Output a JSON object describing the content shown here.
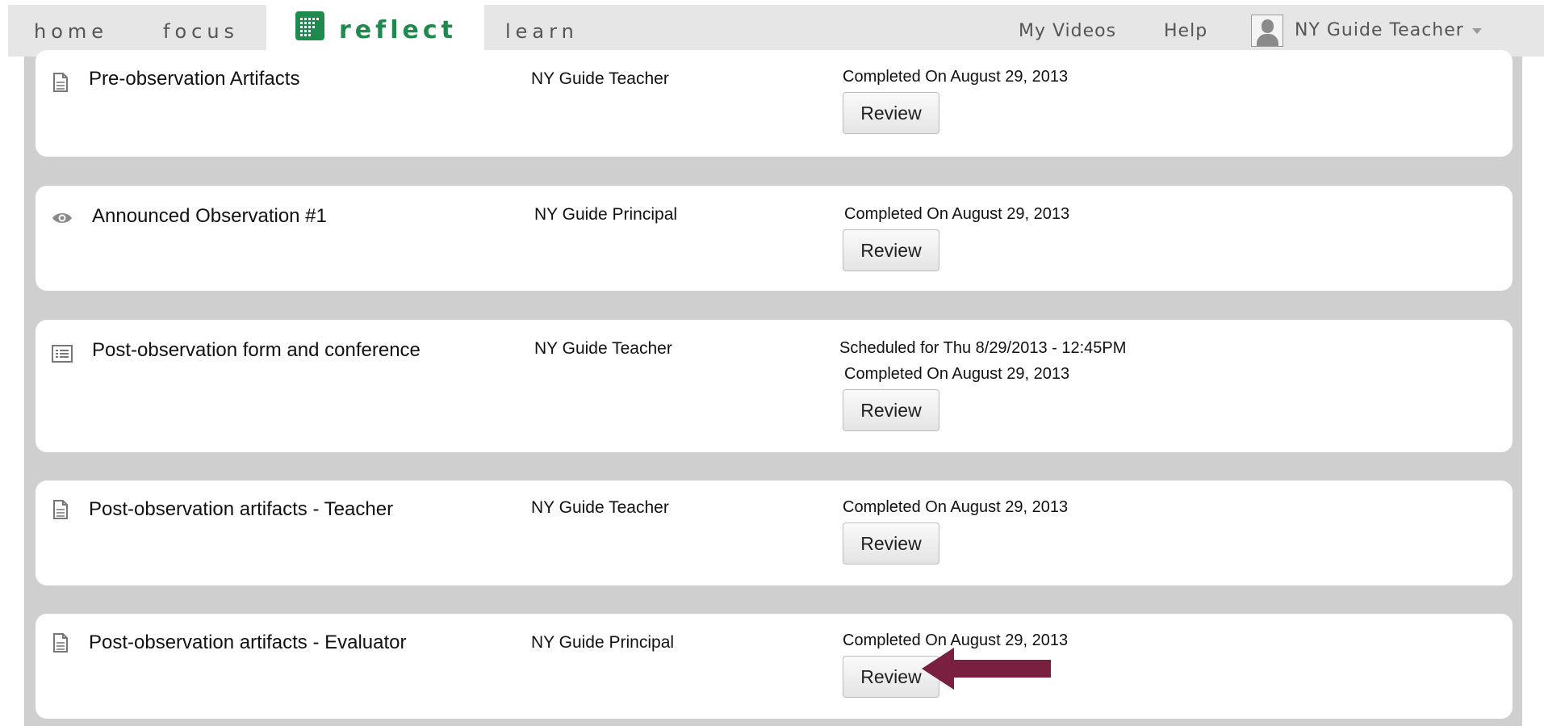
{
  "nav": {
    "home": "home",
    "focus": "focus",
    "reflect": "reflect",
    "learn": "learn",
    "my_videos": "My Videos",
    "help": "Help",
    "user": "NY Guide Teacher"
  },
  "colors": {
    "brand_green": "#1e8a4e",
    "arrow": "#7a1f3f",
    "panel_bg": "#cfcfcf"
  },
  "cards": [
    {
      "icon": "document-icon",
      "title": "Pre-observation Artifacts",
      "owner": "NY Guide Teacher",
      "scheduled": "",
      "status": "Completed On August 29, 2013",
      "button": "Review"
    },
    {
      "icon": "eye-icon",
      "title": "Announced Observation #1",
      "owner": "NY Guide Principal",
      "scheduled": "",
      "status": "Completed On August 29, 2013",
      "button": "Review"
    },
    {
      "icon": "list-form-icon",
      "title": "Post-observation form and conference",
      "owner": "NY Guide Teacher",
      "scheduled": "Scheduled for Thu 8/29/2013 - 12:45PM",
      "status": "Completed On August 29, 2013",
      "button": "Review"
    },
    {
      "icon": "document-icon",
      "title": "Post-observation artifacts - Teacher",
      "owner": "NY Guide Teacher",
      "scheduled": "",
      "status": "Completed On August 29, 2013",
      "button": "Review"
    },
    {
      "icon": "document-icon",
      "title": "Post-observation artifacts - Evaluator",
      "owner": "NY Guide Principal",
      "scheduled": "",
      "status": "Completed On August 29, 2013",
      "button": "Review"
    }
  ]
}
